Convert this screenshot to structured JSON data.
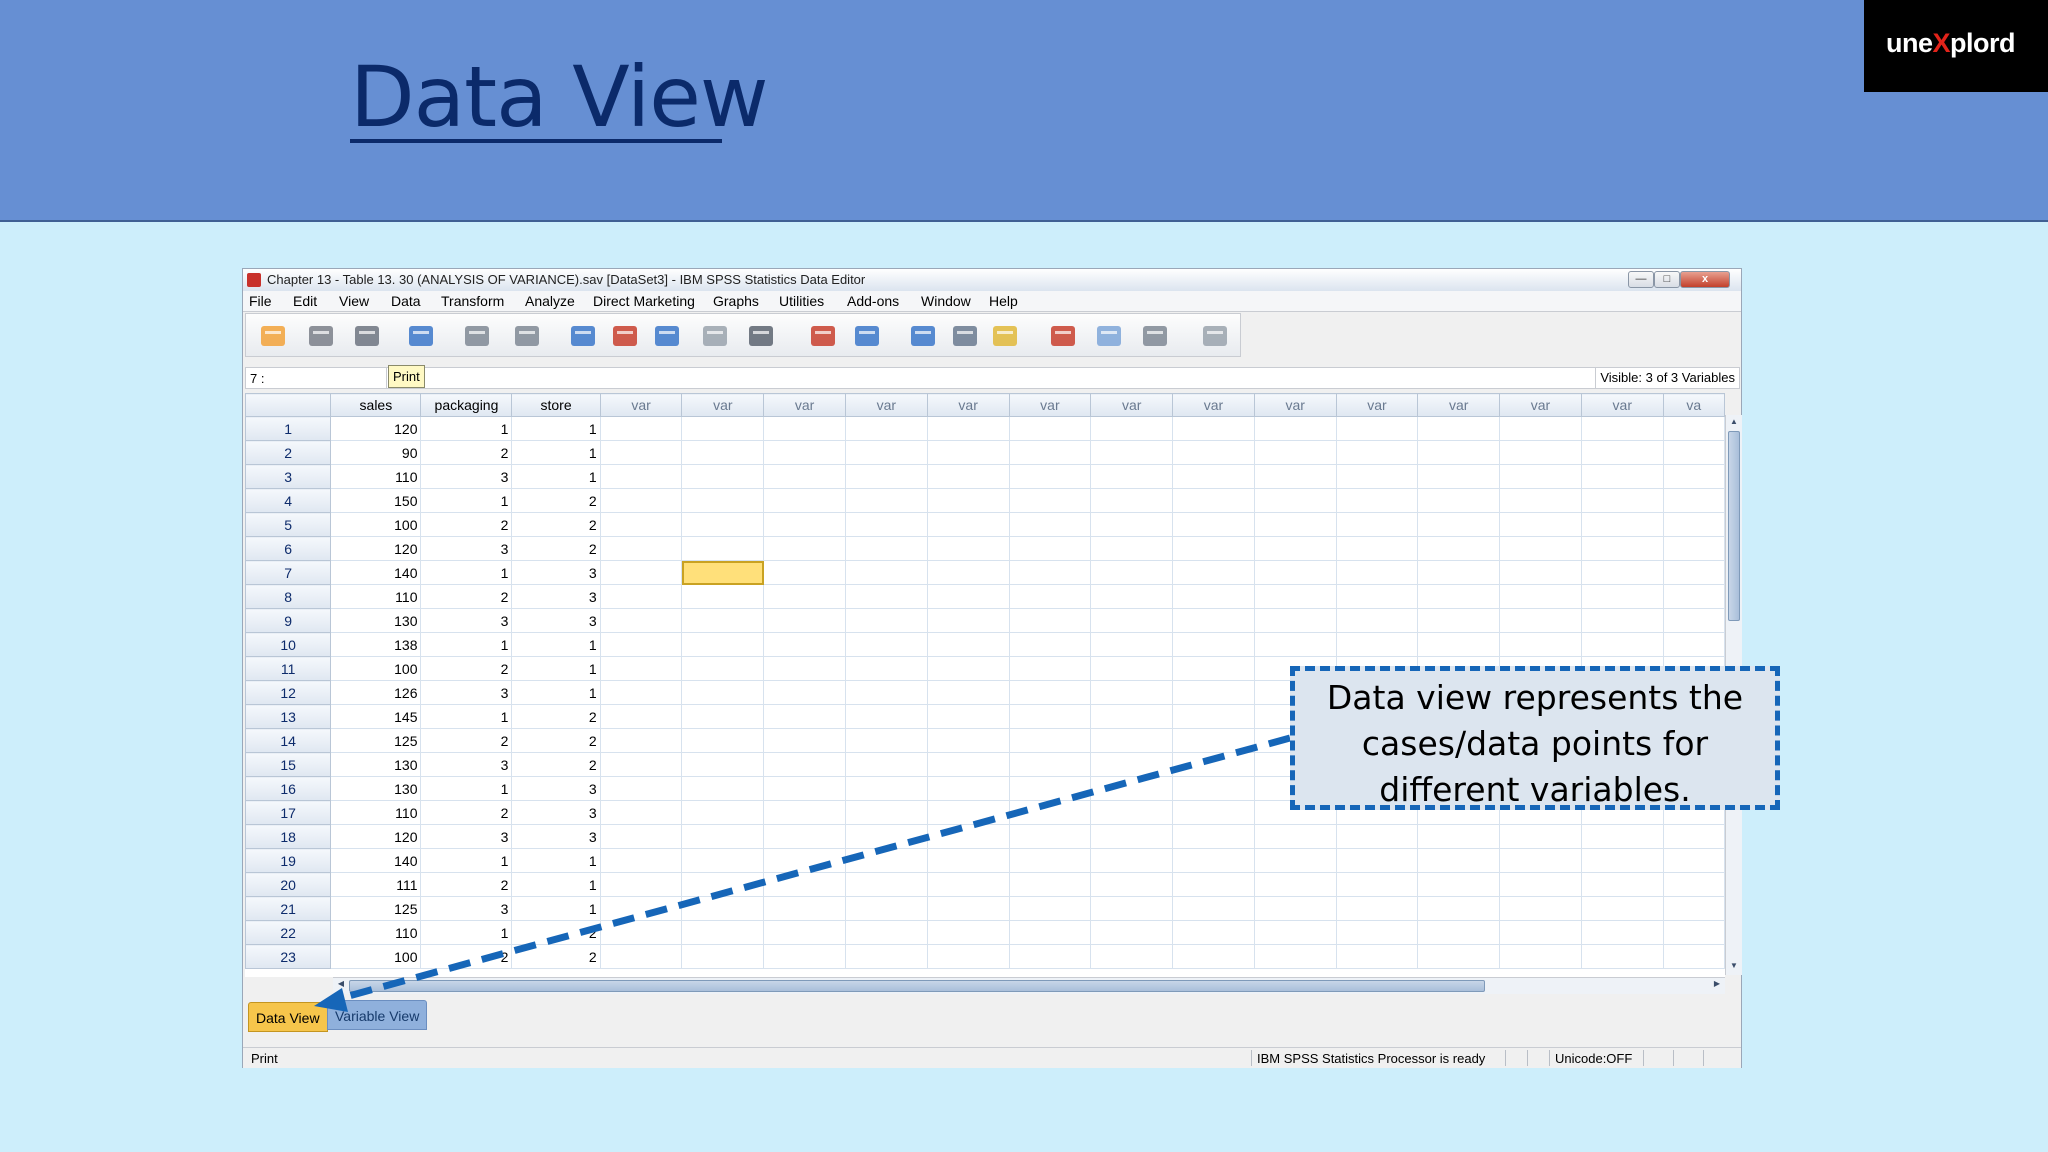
{
  "slide": {
    "title": "Data View",
    "brand_pre": "une",
    "brand_x": "X",
    "brand_post": "plord"
  },
  "window": {
    "title": "Chapter 13 - Table 13. 30 (ANALYSIS OF VARIANCE).sav [DataSet3] - IBM SPSS Statistics Data Editor",
    "close_label": "x"
  },
  "menu": [
    "File",
    "Edit",
    "View",
    "Data",
    "Transform",
    "Analyze",
    "Direct Marketing",
    "Graphs",
    "Utilities",
    "Add-ons",
    "Window",
    "Help"
  ],
  "toolbar": {
    "icons": [
      "open-folder-icon",
      "save-icon",
      "print-icon",
      "dialog-recall-icon",
      "undo-icon",
      "redo-icon",
      "goto-case-icon",
      "goto-variable-icon",
      "variables-icon",
      "run-descriptives-icon",
      "find-icon",
      "insert-cases-icon",
      "insert-variable-icon",
      "split-file-icon",
      "weight-cases-icon",
      "select-cases-icon",
      "value-labels-icon",
      "use-sets-icon",
      "show-all-variables-icon",
      "spell-check-icon"
    ]
  },
  "tooltip": "Print",
  "formula_bar": {
    "cell_ref": "7 :",
    "visible_vars": "Visible: 3 of 3 Variables"
  },
  "grid": {
    "columns": [
      "sales",
      "packaging",
      "store"
    ],
    "empty_column_label": "var",
    "last_partial_column_label": "va",
    "empty_column_count": 13,
    "selected_row": 7,
    "selected_empty_column": 2,
    "rows": [
      {
        "n": "1",
        "sales": "120",
        "packaging": "1",
        "store": "1"
      },
      {
        "n": "2",
        "sales": "90",
        "packaging": "2",
        "store": "1"
      },
      {
        "n": "3",
        "sales": "110",
        "packaging": "3",
        "store": "1"
      },
      {
        "n": "4",
        "sales": "150",
        "packaging": "1",
        "store": "2"
      },
      {
        "n": "5",
        "sales": "100",
        "packaging": "2",
        "store": "2"
      },
      {
        "n": "6",
        "sales": "120",
        "packaging": "3",
        "store": "2"
      },
      {
        "n": "7",
        "sales": "140",
        "packaging": "1",
        "store": "3"
      },
      {
        "n": "8",
        "sales": "110",
        "packaging": "2",
        "store": "3"
      },
      {
        "n": "9",
        "sales": "130",
        "packaging": "3",
        "store": "3"
      },
      {
        "n": "10",
        "sales": "138",
        "packaging": "1",
        "store": "1"
      },
      {
        "n": "11",
        "sales": "100",
        "packaging": "2",
        "store": "1"
      },
      {
        "n": "12",
        "sales": "126",
        "packaging": "3",
        "store": "1"
      },
      {
        "n": "13",
        "sales": "145",
        "packaging": "1",
        "store": "2"
      },
      {
        "n": "14",
        "sales": "125",
        "packaging": "2",
        "store": "2"
      },
      {
        "n": "15",
        "sales": "130",
        "packaging": "3",
        "store": "2"
      },
      {
        "n": "16",
        "sales": "130",
        "packaging": "1",
        "store": "3"
      },
      {
        "n": "17",
        "sales": "110",
        "packaging": "2",
        "store": "3"
      },
      {
        "n": "18",
        "sales": "120",
        "packaging": "3",
        "store": "3"
      },
      {
        "n": "19",
        "sales": "140",
        "packaging": "1",
        "store": "1"
      },
      {
        "n": "20",
        "sales": "111",
        "packaging": "2",
        "store": "1"
      },
      {
        "n": "21",
        "sales": "125",
        "packaging": "3",
        "store": "1"
      },
      {
        "n": "22",
        "sales": "110",
        "packaging": "1",
        "store": "2"
      },
      {
        "n": "23",
        "sales": "100",
        "packaging": "2",
        "store": "2"
      }
    ]
  },
  "tabs": {
    "data_view": "Data View",
    "variable_view": "Variable View"
  },
  "status": {
    "left": "Print",
    "processor": "IBM SPSS Statistics Processor is ready",
    "unicode": "Unicode:OFF"
  },
  "callout": {
    "line1": "Data view represents the",
    "line2": "cases/data points for",
    "line3": "different variables."
  },
  "colors": {
    "header_bg": "#668fd3",
    "page_bg": "#cdeefb",
    "title_color": "#0b2a6a",
    "arrow_color": "#1666b8",
    "active_tab": "#f6c54b"
  }
}
